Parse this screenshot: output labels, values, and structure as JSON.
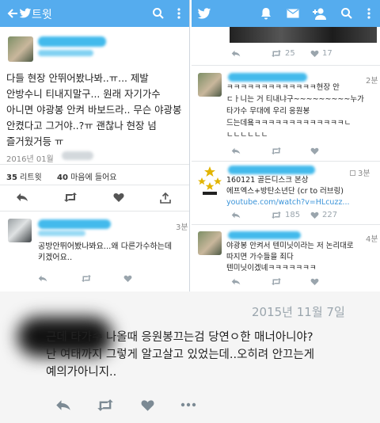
{
  "left": {
    "header_title": "트윗",
    "tweet": {
      "lines": [
        "다들 현장 안뛰어봤나봐..ㅠ... 제발",
        "안방수니 티내지말구... 원래 자기가수",
        "아니면 야광봉 안켜 바보드라.. 무슨 야광봉",
        "안켰다고 그거야..?ㅠ 괜찮나 현장 넘",
        "즐거웠거등 ㅠ"
      ],
      "date": "2016년 01월",
      "retweets_count": "35",
      "retweets_label": "리트윗",
      "likes_count": "40",
      "likes_label": "마음에 들어요"
    },
    "reply": {
      "time": "3분",
      "lines": [
        "공방안뛰어봤나봐요...왜 다른가수하는데",
        "키겠어요.."
      ]
    }
  },
  "right": {
    "top_tweet": {
      "retweets": "25",
      "likes": "17"
    },
    "t1": {
      "time": "2분",
      "lines": [
        "ㅋㅋㅋㅋㅋㅋㅋㅋㅋㅋㅋㅋㅋ현장 안",
        "ㄷㅏ니는 거 티내냐구~~~~~~~~~누가",
        "타가수 무대에 우리 응원봉",
        "드는데욬ㅋㅋㅋㅋㅋㅋㅋㅋㅋㅋㅋㅋㅋㄴ",
        "ㄴㄴㄴㄴㄴㄴ"
      ]
    },
    "t2": {
      "time": "3분",
      "lines": [
        "160121 골든디스크 본상",
        "에프엑스+방탄소년단 (cr to 러브링)"
      ],
      "link": "youtube.com/watch?v=HLcuzz...",
      "retweets": "185",
      "likes": "227"
    },
    "t3": {
      "time": "4분",
      "lines": [
        "야광봉 안켜서 텐미닛이라는 저 논리대로",
        "따지면 가수들을 죄다",
        "텐미닛이겠녜ㅋㅋㅋㅋㅋㅋㅋ"
      ]
    }
  },
  "bottom": {
    "date": "2015년 11월 7일",
    "lines": [
      "근데 타가수 나올때 응원봉끄는검 당연ㅇ한 매너아니야?",
      "난 여태까지 그렇게 알고살고 있었는데..오히려 안끄는게",
      "예의가아니지.."
    ]
  },
  "colors": {
    "header": "#55acee",
    "link": "#3b94d9",
    "blur": "#2fb3ea"
  }
}
